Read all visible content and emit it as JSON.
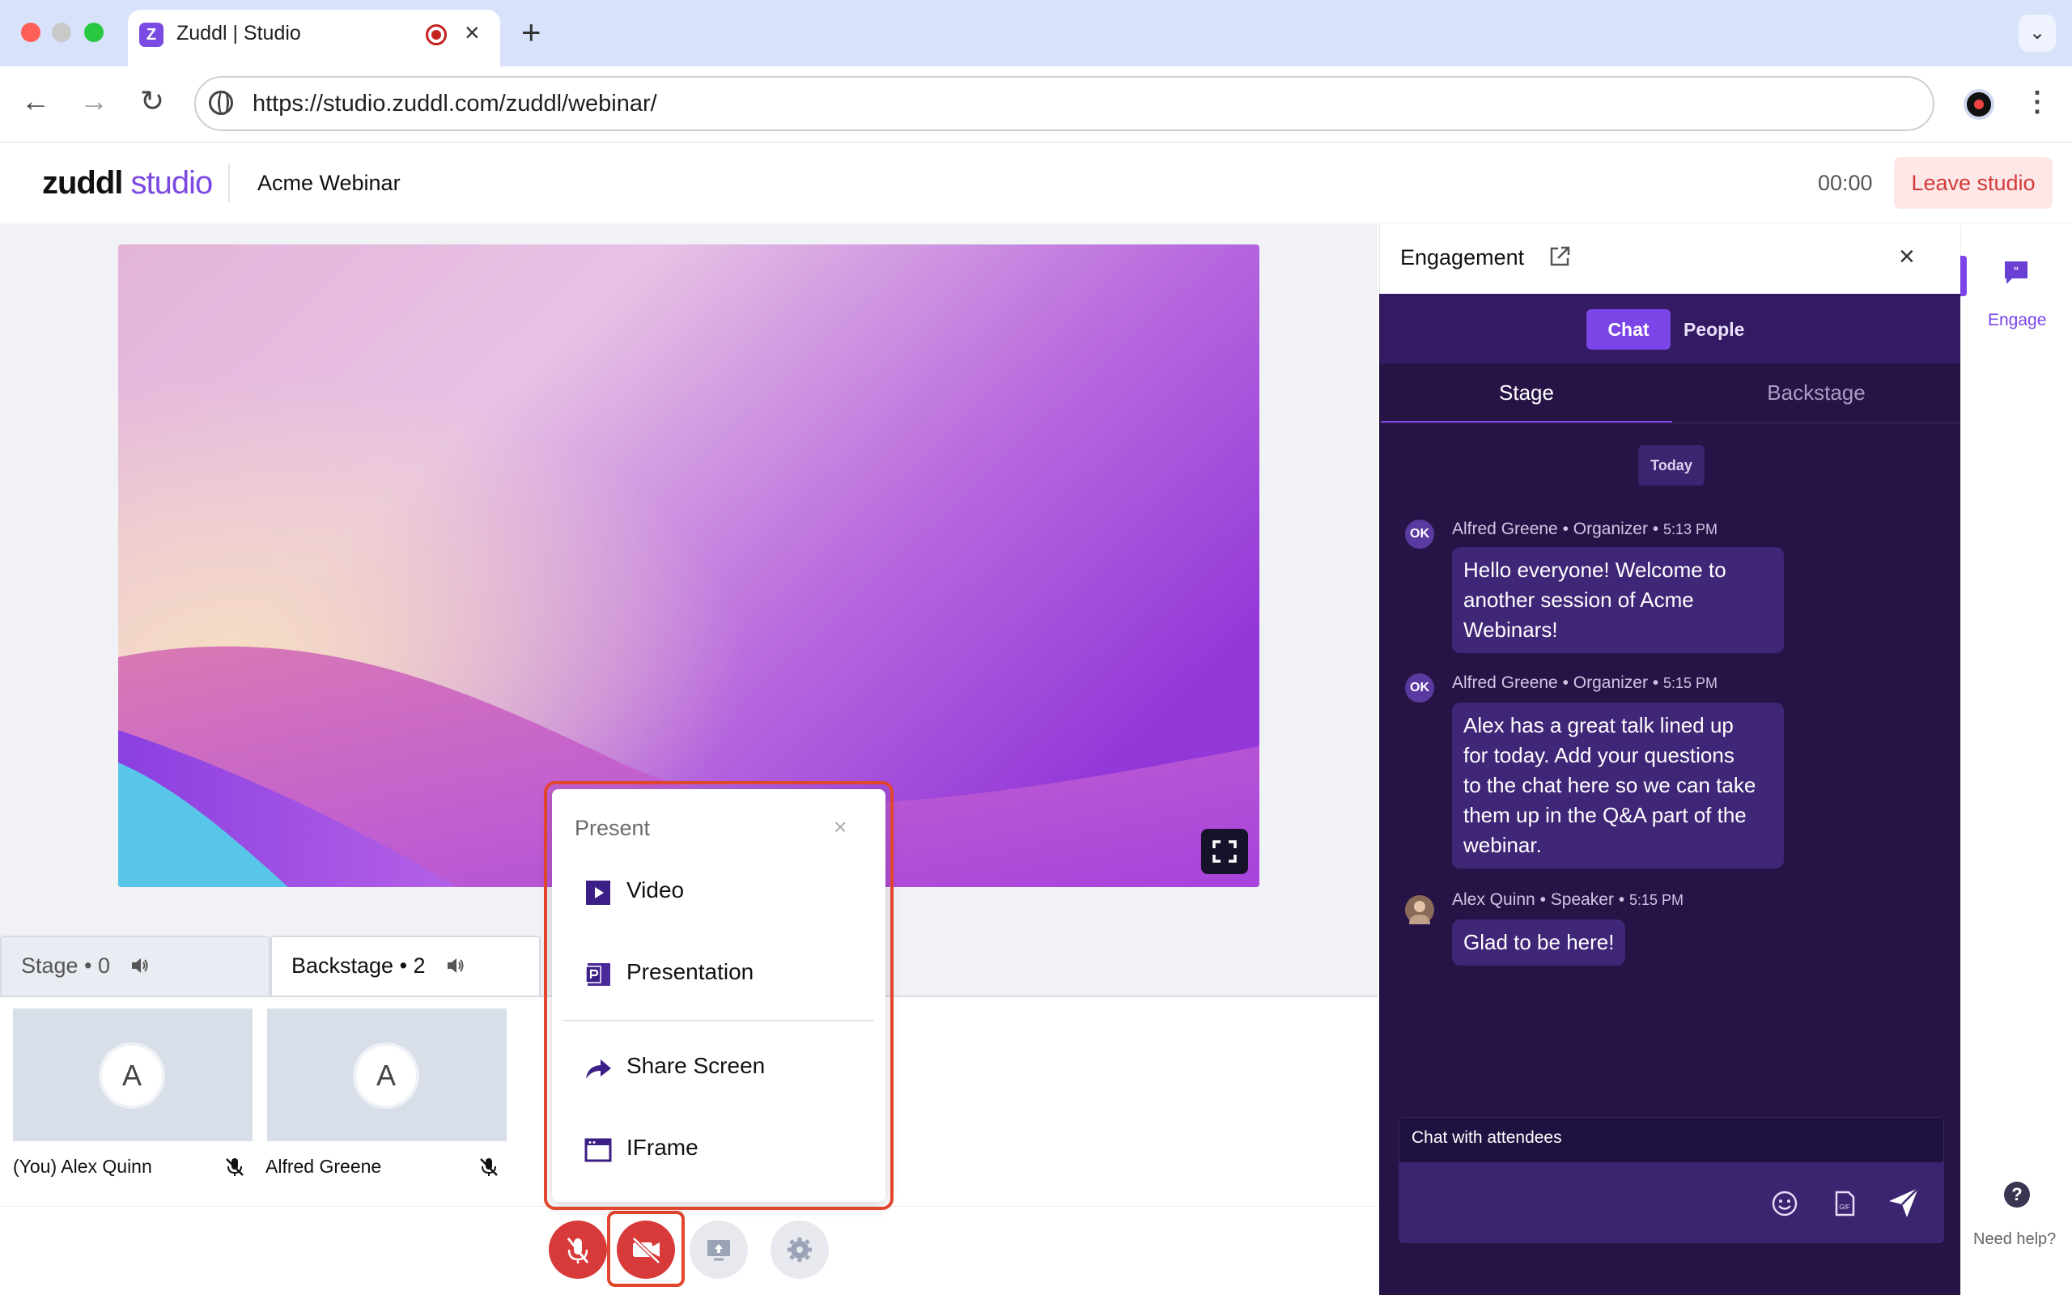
{
  "browser": {
    "tab_title": "Zuddl | Studio",
    "favicon_letter": "Z",
    "url": "https://studio.zuddl.com/zuddl/webinar/",
    "new_tab": "+",
    "close": "×"
  },
  "header": {
    "logo_main": "zuddl",
    "logo_studio": "studio",
    "event_title": "Acme Webinar",
    "timer": "00:00",
    "leave_label": "Leave studio"
  },
  "tracks": {
    "stage_label": "Stage • 0",
    "backstage_label": "Backstage • 2"
  },
  "participants": [
    {
      "initial": "A",
      "name": "(You) Alex Quinn",
      "muted": true
    },
    {
      "initial": "A",
      "name": "Alfred Greene",
      "muted": true
    }
  ],
  "present_menu": {
    "title": "Present",
    "close": "×",
    "items": [
      {
        "label": "Video",
        "icon": "play-video-icon"
      },
      {
        "label": "Presentation",
        "icon": "presentation-icon"
      },
      {
        "label": "Share Screen",
        "icon": "share-arrow-icon"
      },
      {
        "label": "IFrame",
        "icon": "browser-window-icon"
      }
    ]
  },
  "engagement": {
    "title": "Engagement",
    "close": "×",
    "segments": {
      "chat": "Chat",
      "people": "People"
    },
    "subtabs": {
      "stage": "Stage",
      "backstage": "Backstage"
    },
    "date_divider": "Today",
    "messages": [
      {
        "avatar": "OK",
        "name": "Alfred Greene",
        "role": "Organizer",
        "time": "5:13 PM",
        "text_lines": [
          "Hello everyone! Welcome to",
          "another session of Acme",
          "Webinars!"
        ]
      },
      {
        "avatar": "OK",
        "name": "Alfred Greene",
        "role": "Organizer",
        "time": "5:15 PM",
        "text_lines": [
          "Alex has a great talk lined up",
          "for today. Add your questions",
          "to the chat here so we can take",
          "them up in the Q&A part of the",
          "webinar."
        ]
      },
      {
        "avatar": "",
        "name": "Alex Quinn",
        "role": "Speaker",
        "time": "5:15 PM",
        "text_lines": [
          "Glad to be here!"
        ]
      }
    ],
    "input_placeholder": "Chat with attendees"
  },
  "rail": {
    "engage_label": "Engage",
    "help_icon": "?",
    "help_label": "Need help?"
  },
  "colors": {
    "brand_purple": "#7b45e8",
    "chat_bg": "#271446",
    "danger_red": "#d83a3a",
    "highlight_red": "#e2452d"
  }
}
